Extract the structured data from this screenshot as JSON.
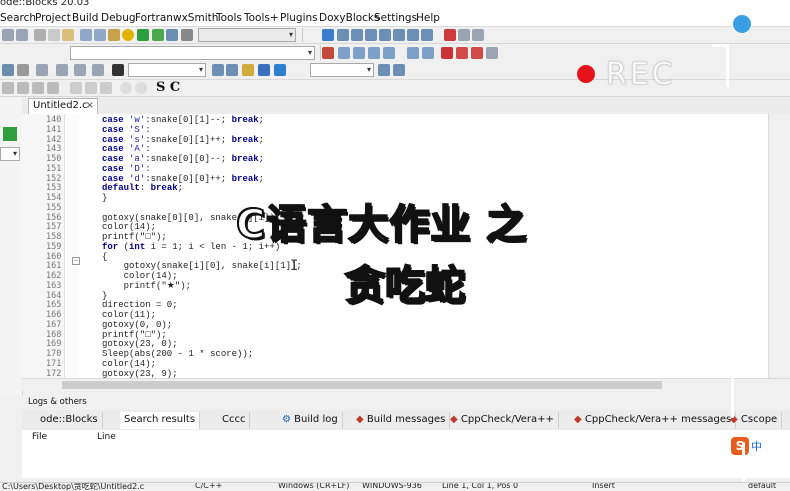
{
  "window": {
    "title": "ode::Blocks 20.03"
  },
  "menu": [
    "Search",
    "Project",
    "Build",
    "Debug",
    "Fortran",
    "wxSmith",
    "Tools",
    "Tools+",
    "Plugins",
    "DoxyBlocks",
    "Settings",
    "Help"
  ],
  "editor": {
    "tab_label": "Untitled2.c",
    "tab_close": "×",
    "lines": [
      {
        "n": "140",
        "t": "case 'w':snake[0][1]--; break;"
      },
      {
        "n": "141",
        "t": "case 'S':"
      },
      {
        "n": "142",
        "t": "case 's':snake[0][1]++; break;"
      },
      {
        "n": "143",
        "t": "case 'A':"
      },
      {
        "n": "150",
        "t": "case 'a':snake[0][0]--; break;"
      },
      {
        "n": "151",
        "t": "case 'D':"
      },
      {
        "n": "152",
        "t": "case 'd':snake[0][0]++; break;"
      },
      {
        "n": "153",
        "t": "default: break;"
      },
      {
        "n": "154",
        "t": "}"
      },
      {
        "n": "155",
        "t": ""
      },
      {
        "n": "156",
        "t": "gotoxy(snake[0][0], snake[0][1]);"
      },
      {
        "n": "157",
        "t": "color(14);"
      },
      {
        "n": "158",
        "t": "printf(\"□\");"
      },
      {
        "n": "159",
        "t": "for (int i = 1; i < len - 1; i++)"
      },
      {
        "n": "160",
        "t": "{"
      },
      {
        "n": "161",
        "t": "    gotoxy(snake[i][0], snake[i][1]);"
      },
      {
        "n": "162",
        "t": "    color(14);"
      },
      {
        "n": "163",
        "t": "    printf(\"★\");"
      },
      {
        "n": "164",
        "t": "}"
      },
      {
        "n": "165",
        "t": "direction = 0;"
      },
      {
        "n": "166",
        "t": "color(11);"
      },
      {
        "n": "167",
        "t": "gotoxy(0, 0);"
      },
      {
        "n": "168",
        "t": "printf(\"□\");"
      },
      {
        "n": "169",
        "t": "gotoxy(23, 0);"
      },
      {
        "n": "170",
        "t": "Sleep(abs(200 - 1 * score));"
      },
      {
        "n": "171",
        "t": "color(14);"
      },
      {
        "n": "172",
        "t": "gotoxy(23, 9);"
      }
    ]
  },
  "logs": {
    "header": "Logs & others",
    "tabs": [
      "ode::Blocks",
      "Search results",
      "Cccc",
      "Build log",
      "Build messages",
      "CppCheck/Vera++",
      "CppCheck/Vera++ messages",
      "Cscope"
    ],
    "columns": [
      "File",
      "Line"
    ]
  },
  "statusbar": [
    "C:\\Users\\Desktop\\贪吃蛇\\Untitled2.c",
    "C/C++",
    "Windows (CR+LF)",
    "WINDOWS-936",
    "Line 1, Col 1, Pos 0",
    "Insert",
    "default"
  ],
  "overlay": {
    "title": "C语言大作业 之",
    "subtitle": "贪吃蛇",
    "rec": "REC",
    "ime": "中"
  },
  "toolbar": {
    "sc_label": "S C"
  },
  "colors": {
    "rec_dot": "#e5141b",
    "keyword": "#00008b",
    "ime_badge": "#e85c1e"
  }
}
